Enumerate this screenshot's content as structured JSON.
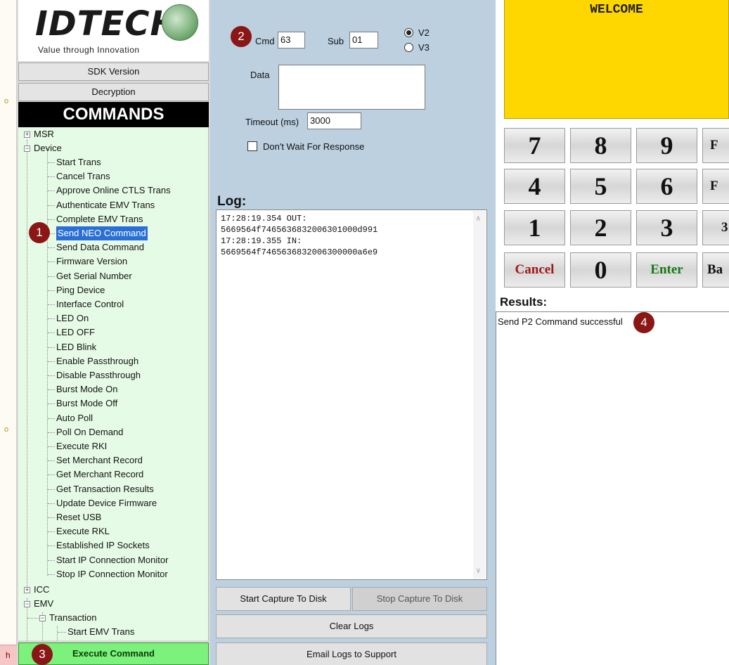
{
  "logo": {
    "brand": "IDTECH",
    "tagline": "Value through Innovation"
  },
  "left_strip": {
    "marks": [
      "o",
      "o"
    ],
    "tab_label": "h"
  },
  "sidebar": {
    "sdk_version": "SDK Version",
    "decryption": "Decryption",
    "commands_header": "COMMANDS",
    "execute": "Execute Command"
  },
  "tree": {
    "msr": "MSR",
    "device": "Device",
    "device_items": [
      "Start Trans",
      "Cancel Trans",
      "Approve Online CTLS Trans",
      "Authenticate EMV Trans",
      "Complete EMV Trans",
      "Send NEO Command",
      "Send Data Command",
      "Firmware Version",
      "Get Serial Number",
      "Ping Device",
      "Interface Control",
      "LED On",
      "LED OFF",
      "LED Blink",
      "Enable Passthrough",
      "Disable Passthrough",
      "Burst Mode On",
      "Burst Mode Off",
      "Auto Poll",
      "Poll On Demand",
      "Execute RKI",
      "Set Merchant Record",
      "Get Merchant Record",
      "Get Transaction Results",
      "Update Device Firmware",
      "Reset USB",
      "Execute RKL",
      "Established IP Sockets",
      "Start IP Connection Monitor",
      "Stop IP Connection Monitor"
    ],
    "selected": "Send NEO Command",
    "icc": "ICC",
    "emv": "EMV",
    "transaction": "Transaction",
    "start_emv": "Start EMV Trans"
  },
  "command_form": {
    "cmd_label": "Cmd",
    "cmd_value": "63",
    "sub_label": "Sub",
    "sub_value": "01",
    "v2_label": "V2",
    "v3_label": "V3",
    "selected_version": "V2",
    "data_label": "Data",
    "data_value": "",
    "timeout_label": "Timeout (ms)",
    "timeout_value": "3000",
    "dont_wait_label": "Don't Wait For Response",
    "dont_wait_checked": false
  },
  "log": {
    "title": "Log:",
    "lines": [
      "17:28:19.354 OUT:",
      "5669564f7465636832006301000d991",
      "17:28:19.355 IN:",
      "5669564f7465636832006300000a6e9"
    ]
  },
  "log_buttons": {
    "start_capture": "Start Capture To Disk",
    "stop_capture": "Stop Capture To Disk",
    "clear_logs": "Clear Logs",
    "email_logs": "Email Logs to Support"
  },
  "display": {
    "message": "WELCOME"
  },
  "keypad": {
    "row1": [
      "7",
      "8",
      "9",
      "F"
    ],
    "row2": [
      "4",
      "5",
      "6",
      "F"
    ],
    "row3": [
      "1",
      "2",
      "3",
      "3"
    ],
    "row4": [
      "Cancel",
      "0",
      "Enter",
      "Ba"
    ]
  },
  "results": {
    "title": "Results:",
    "text": "Send P2 Command successful"
  },
  "callouts": [
    "1",
    "2",
    "3",
    "4"
  ],
  "colors": {
    "tree_bg": "#e6fbe6",
    "selection": "#2a6fd6",
    "execute_bg": "#7cf27c",
    "display_bg": "#ffd700",
    "mid_bg": "#bcd0e0",
    "callout_bg": "#8a1616"
  }
}
